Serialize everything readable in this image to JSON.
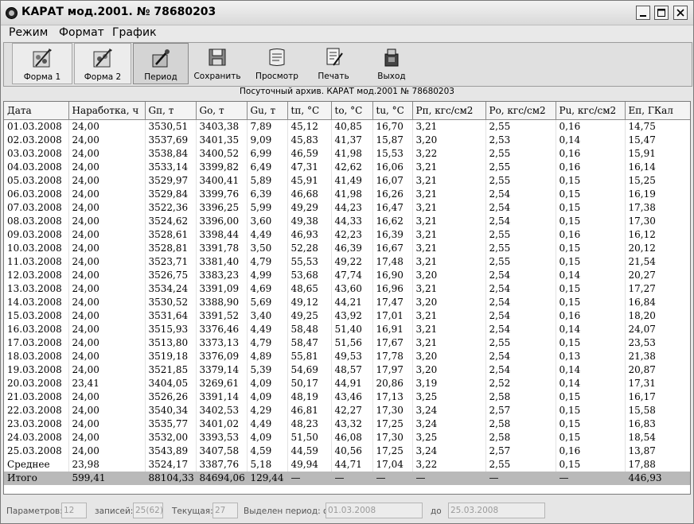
{
  "window": {
    "title": "КАРАТ мод.2001. № 78680203"
  },
  "menu": [
    {
      "label": "Режим"
    },
    {
      "label": "Формат"
    },
    {
      "label": "График"
    }
  ],
  "toolbar": [
    {
      "label": "Форма 1",
      "icon": "form1-icon"
    },
    {
      "label": "Форма 2",
      "icon": "form2-icon"
    },
    {
      "label": "Период",
      "icon": "period-icon"
    },
    {
      "label": "Сохранить",
      "icon": "floppy-disk-icon"
    },
    {
      "label": "Просмотр",
      "icon": "scroll-preview-icon"
    },
    {
      "label": "Печать",
      "icon": "print-icon"
    },
    {
      "label": "Выход",
      "icon": "exit-icon"
    }
  ],
  "caption": "Посуточный архив. КАРАТ мод.2001 № 78680203",
  "table": {
    "columns": [
      "Дата",
      "Наработка, ч",
      "Gп, т",
      "Gо, т",
      "Gu, т",
      "tп, °С",
      "tо, °С",
      "tu, °С",
      "Рп, кгс/см2",
      "Ро, кгс/см2",
      "Рu, кгс/см2",
      "Еп, ГКал"
    ],
    "rows": [
      [
        "01.03.2008",
        "24,00",
        "3530,51",
        "3403,38",
        "7,89",
        "45,12",
        "40,85",
        "16,70",
        "3,21",
        "2,55",
        "0,16",
        "14,75"
      ],
      [
        "02.03.2008",
        "24,00",
        "3537,69",
        "3401,35",
        "9,09",
        "45,83",
        "41,37",
        "15,87",
        "3,20",
        "2,53",
        "0,14",
        "15,47"
      ],
      [
        "03.03.2008",
        "24,00",
        "3538,84",
        "3400,52",
        "6,99",
        "46,59",
        "41,98",
        "15,53",
        "3,22",
        "2,55",
        "0,16",
        "15,91"
      ],
      [
        "04.03.2008",
        "24,00",
        "3533,14",
        "3399,82",
        "6,49",
        "47,31",
        "42,62",
        "16,06",
        "3,21",
        "2,55",
        "0,16",
        "16,14"
      ],
      [
        "05.03.2008",
        "24,00",
        "3529,97",
        "3400,41",
        "5,89",
        "45,91",
        "41,49",
        "16,07",
        "3,21",
        "2,55",
        "0,15",
        "15,25"
      ],
      [
        "06.03.2008",
        "24,00",
        "3529,84",
        "3399,76",
        "6,39",
        "46,68",
        "41,98",
        "16,26",
        "3,21",
        "2,54",
        "0,15",
        "16,19"
      ],
      [
        "07.03.2008",
        "24,00",
        "3522,36",
        "3396,25",
        "5,99",
        "49,29",
        "44,23",
        "16,47",
        "3,21",
        "2,54",
        "0,15",
        "17,38"
      ],
      [
        "08.03.2008",
        "24,00",
        "3524,62",
        "3396,00",
        "3,60",
        "49,38",
        "44,33",
        "16,62",
        "3,21",
        "2,54",
        "0,15",
        "17,30"
      ],
      [
        "09.03.2008",
        "24,00",
        "3528,61",
        "3398,44",
        "4,49",
        "46,93",
        "42,23",
        "16,39",
        "3,21",
        "2,55",
        "0,16",
        "16,12"
      ],
      [
        "10.03.2008",
        "24,00",
        "3528,81",
        "3391,78",
        "3,50",
        "52,28",
        "46,39",
        "16,67",
        "3,21",
        "2,55",
        "0,15",
        "20,12"
      ],
      [
        "11.03.2008",
        "24,00",
        "3523,71",
        "3381,40",
        "4,79",
        "55,53",
        "49,22",
        "17,48",
        "3,21",
        "2,55",
        "0,15",
        "21,54"
      ],
      [
        "12.03.2008",
        "24,00",
        "3526,75",
        "3383,23",
        "4,99",
        "53,68",
        "47,74",
        "16,90",
        "3,20",
        "2,54",
        "0,14",
        "20,27"
      ],
      [
        "13.03.2008",
        "24,00",
        "3534,24",
        "3391,09",
        "4,69",
        "48,65",
        "43,60",
        "16,96",
        "3,21",
        "2,54",
        "0,15",
        "17,27"
      ],
      [
        "14.03.2008",
        "24,00",
        "3530,52",
        "3388,90",
        "5,69",
        "49,12",
        "44,21",
        "17,47",
        "3,20",
        "2,54",
        "0,15",
        "16,84"
      ],
      [
        "15.03.2008",
        "24,00",
        "3531,64",
        "3391,52",
        "3,40",
        "49,25",
        "43,92",
        "17,01",
        "3,21",
        "2,54",
        "0,16",
        "18,20"
      ],
      [
        "16.03.2008",
        "24,00",
        "3515,93",
        "3376,46",
        "4,49",
        "58,48",
        "51,40",
        "16,91",
        "3,21",
        "2,54",
        "0,14",
        "24,07"
      ],
      [
        "17.03.2008",
        "24,00",
        "3513,80",
        "3373,13",
        "4,79",
        "58,47",
        "51,56",
        "17,67",
        "3,21",
        "2,55",
        "0,15",
        "23,53"
      ],
      [
        "18.03.2008",
        "24,00",
        "3519,18",
        "3376,09",
        "4,89",
        "55,81",
        "49,53",
        "17,78",
        "3,20",
        "2,54",
        "0,13",
        "21,38"
      ],
      [
        "19.03.2008",
        "24,00",
        "3521,85",
        "3379,14",
        "5,39",
        "54,69",
        "48,57",
        "17,97",
        "3,20",
        "2,54",
        "0,14",
        "20,87"
      ],
      [
        "20.03.2008",
        "23,41",
        "3404,05",
        "3269,61",
        "4,09",
        "50,17",
        "44,91",
        "20,86",
        "3,19",
        "2,52",
        "0,14",
        "17,31"
      ],
      [
        "21.03.2008",
        "24,00",
        "3526,26",
        "3391,14",
        "4,09",
        "48,19",
        "43,46",
        "17,13",
        "3,25",
        "2,58",
        "0,15",
        "16,17"
      ],
      [
        "22.03.2008",
        "24,00",
        "3540,34",
        "3402,53",
        "4,29",
        "46,81",
        "42,27",
        "17,30",
        "3,24",
        "2,57",
        "0,15",
        "15,58"
      ],
      [
        "23.03.2008",
        "24,00",
        "3535,77",
        "3401,02",
        "4,49",
        "48,23",
        "43,32",
        "17,25",
        "3,24",
        "2,58",
        "0,15",
        "16,83"
      ],
      [
        "24.03.2008",
        "24,00",
        "3532,00",
        "3393,53",
        "4,09",
        "51,50",
        "46,08",
        "17,30",
        "3,25",
        "2,58",
        "0,15",
        "18,54"
      ],
      [
        "25.03.2008",
        "24,00",
        "3543,89",
        "3407,58",
        "4,59",
        "44,59",
        "40,56",
        "17,25",
        "3,24",
        "2,57",
        "0,16",
        "13,87"
      ],
      [
        "Среднее",
        "23,98",
        "3524,17",
        "3387,76",
        "5,18",
        "49,94",
        "44,71",
        "17,04",
        "3,22",
        "2,55",
        "0,15",
        "17,88"
      ]
    ],
    "total": [
      "Итого",
      "599,41",
      "88104,33",
      "84694,06",
      "129,44",
      "—",
      "—",
      "—",
      "—",
      "—",
      "—",
      "446,93"
    ]
  },
  "status": {
    "params_label": "Параметров:",
    "params_value": "12",
    "records_label": "записей:",
    "records_value": "25(62)",
    "current_label": "Текущая:",
    "current_value": "27",
    "period_label": "Выделен период: от",
    "period_from": "01.03.2008",
    "to_label": "до",
    "period_to": "25.03.2008"
  }
}
